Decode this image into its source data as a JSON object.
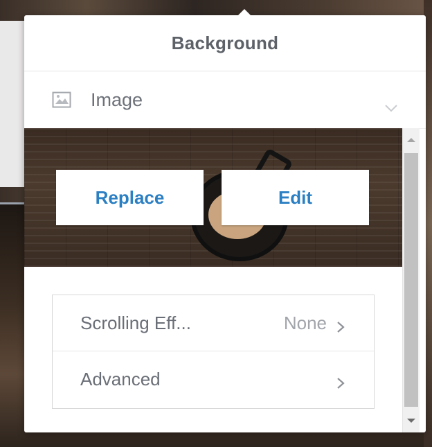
{
  "panel": {
    "title": "Background",
    "type_selector": {
      "icon": "image-icon",
      "label": "Image",
      "chevron": "chevron-down-icon"
    },
    "preview": {
      "replace_label": "Replace",
      "edit_label": "Edit"
    },
    "settings": [
      {
        "label": "Scrolling Eff...",
        "value": "None",
        "icon": "chevron-right-icon"
      },
      {
        "label": "Advanced",
        "value": "",
        "icon": "chevron-right-icon"
      }
    ]
  },
  "colors": {
    "accent_link": "#2b7fc3",
    "title_text": "#5d6168",
    "muted_text": "#a2a5ab"
  }
}
